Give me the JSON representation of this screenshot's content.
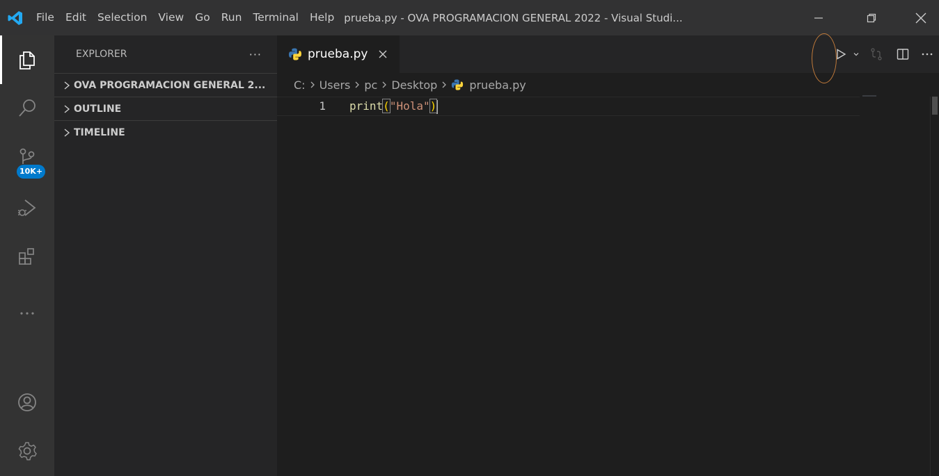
{
  "titlebar": {
    "menu": [
      "File",
      "Edit",
      "Selection",
      "View",
      "Go",
      "Run",
      "Terminal",
      "Help"
    ],
    "title": "prueba.py - OVA PROGRAMACION GENERAL 2022 - Visual Studi..."
  },
  "activity": {
    "icons": [
      "files-icon",
      "search-icon",
      "source-control-icon",
      "run-debug-icon",
      "extensions-icon",
      "more-icon",
      "account-icon",
      "manage-gear-icon"
    ],
    "source_control_badge": "10K+"
  },
  "sidebar": {
    "header": "EXPLORER",
    "header_actions": "···",
    "sections": [
      "OVA PROGRAMACION GENERAL 2...",
      "OUTLINE",
      "TIMELINE"
    ]
  },
  "editor": {
    "tab_label": "prueba.py",
    "breadcrumb": [
      "C:",
      "Users",
      "pc",
      "Desktop",
      "prueba.py"
    ],
    "line_number": "1",
    "code": {
      "fn": "print",
      "open": "(",
      "str": "\"Hola\"",
      "close": ")"
    }
  },
  "colors": {
    "accent": "#007acc",
    "python_blue": "#3a75b0",
    "python_yellow": "#ffd43b",
    "highlight_circle": "#c07a3a"
  }
}
